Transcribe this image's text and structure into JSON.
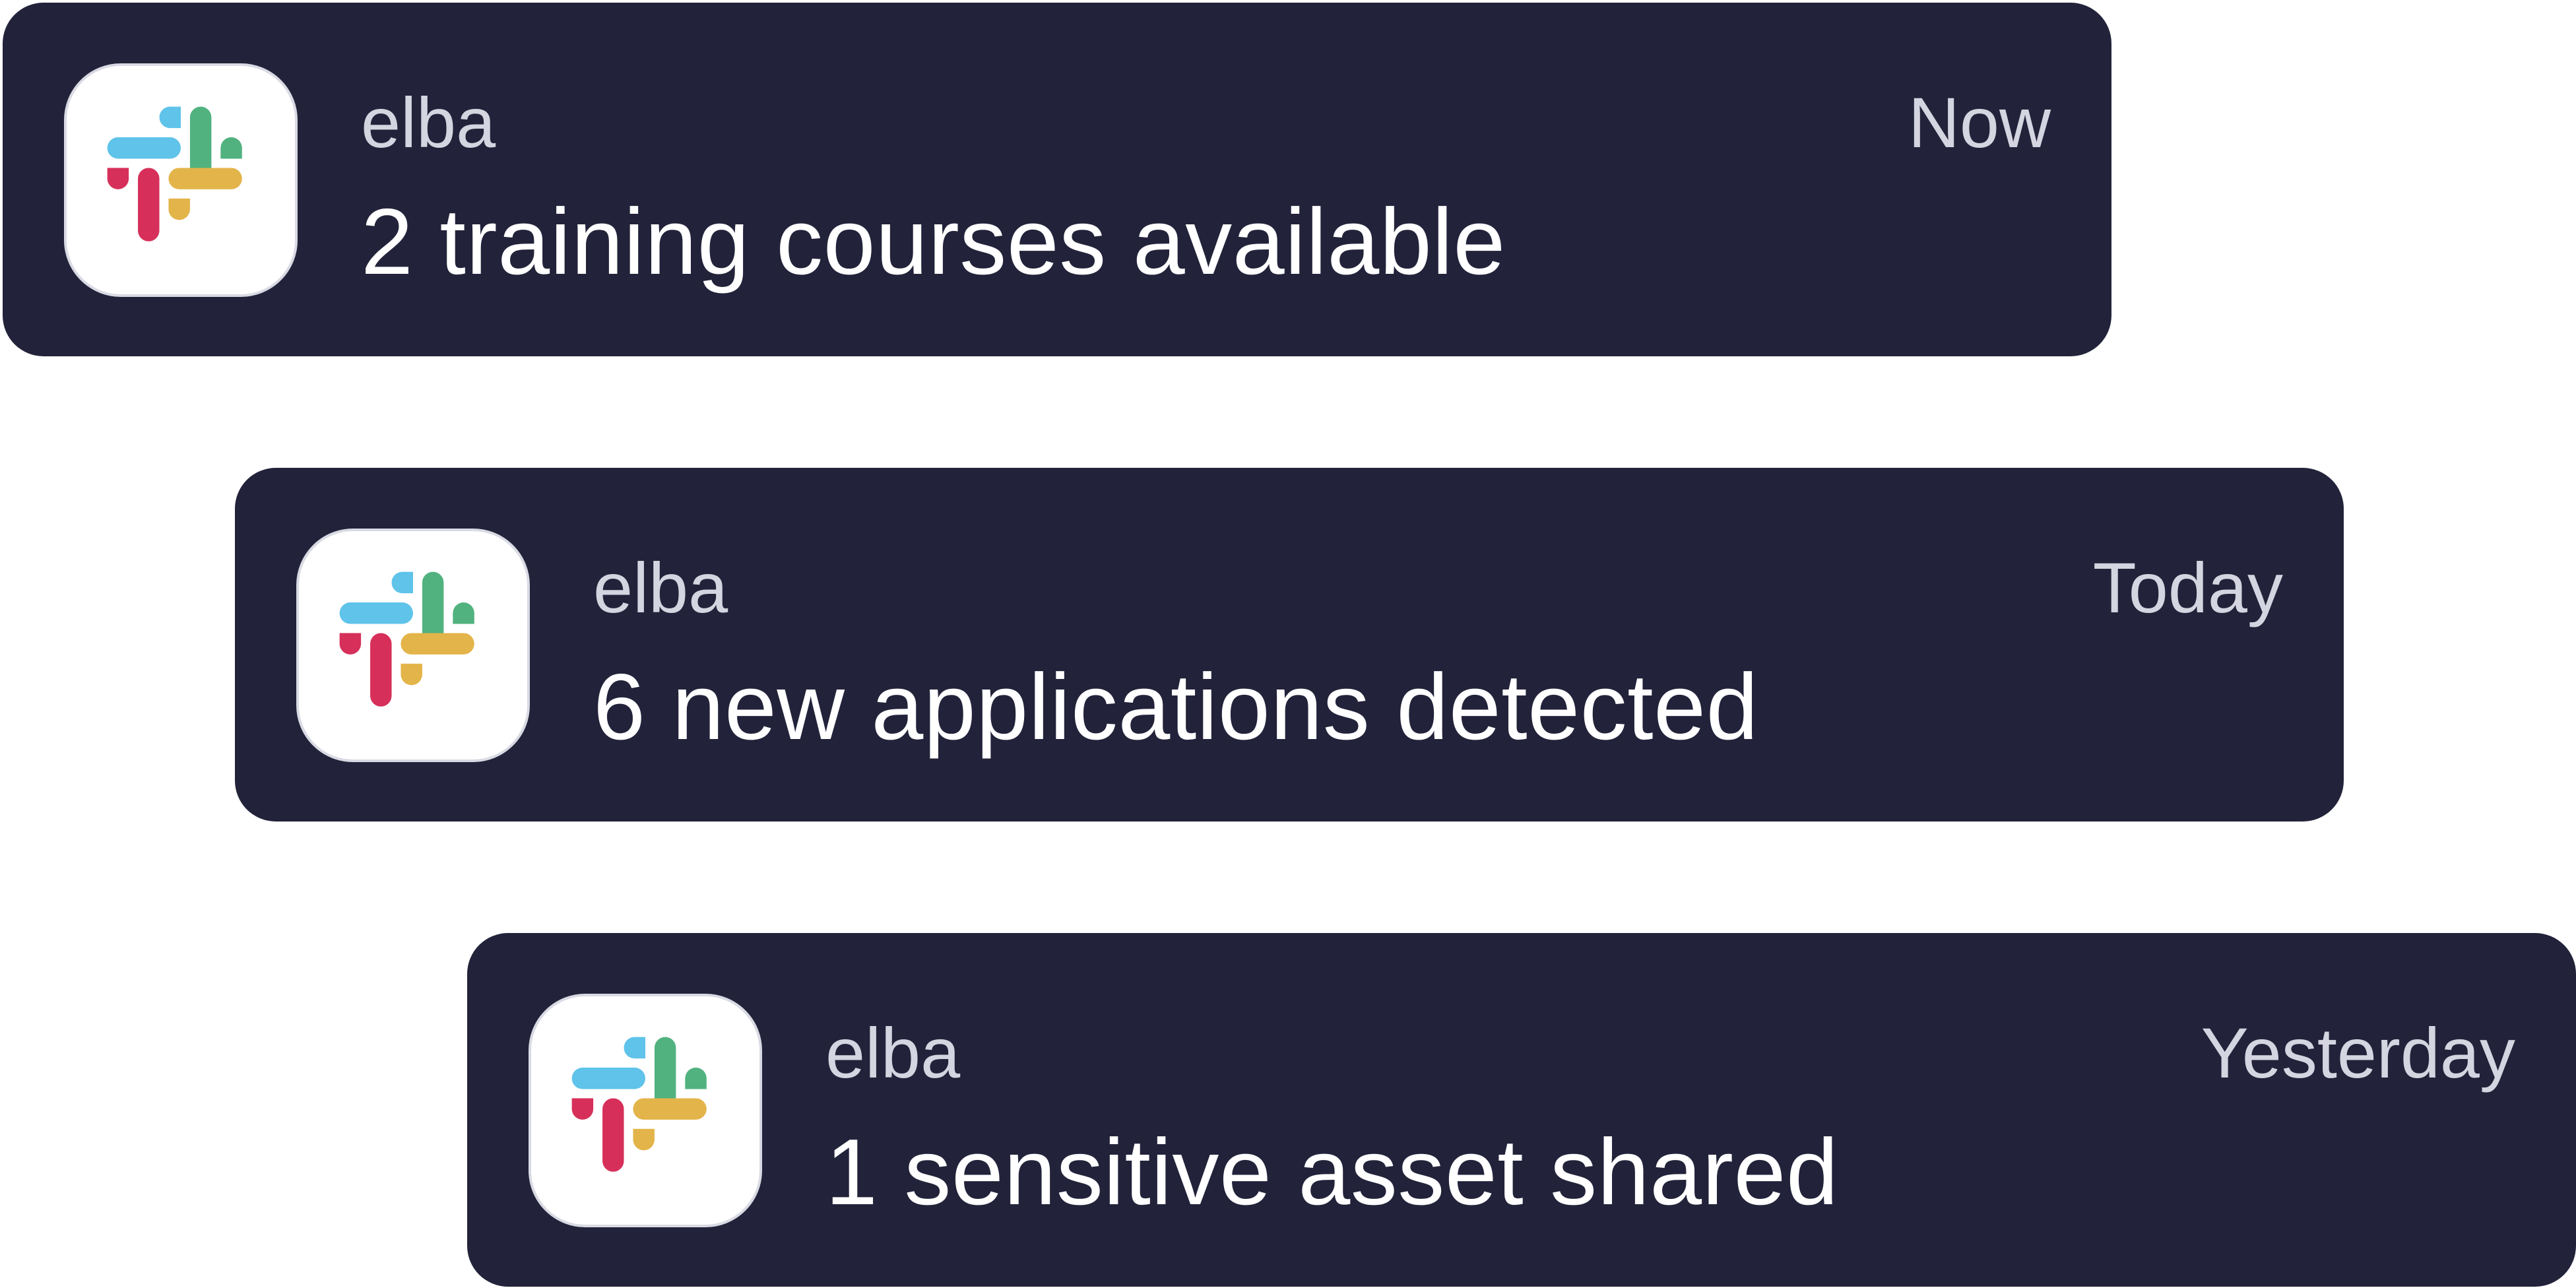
{
  "notifications": [
    {
      "app_name": "elba",
      "time": "Now",
      "message": "2 training courses available",
      "icon": "slack-logo-icon"
    },
    {
      "app_name": "elba",
      "time": "Today",
      "message": "6 new applications detected",
      "icon": "slack-logo-icon"
    },
    {
      "app_name": "elba",
      "time": "Yesterday",
      "message": "1 sensitive asset shared",
      "icon": "slack-logo-icon"
    }
  ],
  "colors": {
    "card_background": "#22233a",
    "meta_text": "#d4d5e0",
    "message_text": "#ffffff",
    "slack_blue": "#5fc3ea",
    "slack_green": "#51b27f",
    "slack_red": "#d6305a",
    "slack_yellow": "#e3b449"
  }
}
